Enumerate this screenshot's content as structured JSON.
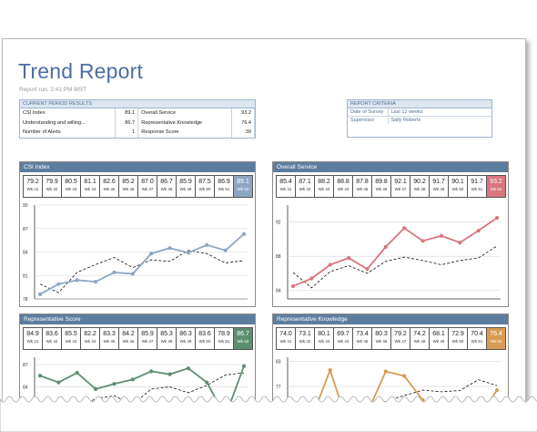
{
  "report": {
    "title": "Trend Report",
    "run": "Report run: 2:41 PM MST"
  },
  "results": {
    "header": "CURRENT PERIOD RESULTS",
    "rows": [
      [
        "CSI Index",
        "89.1",
        "Overall Service",
        "93.2"
      ],
      [
        "Understanding and willing...",
        "86.7",
        "Representative Knowledge",
        "76.4"
      ],
      [
        "Number of Alerts",
        "1",
        "Response Score",
        "39"
      ]
    ]
  },
  "criteria": {
    "header": "REPORT CRITERIA",
    "rows": [
      [
        "Date of Survey",
        "Last 12 weeks"
      ],
      [
        "Supervisor",
        "Sally Roberts"
      ]
    ]
  },
  "colors": {
    "header_blue": "#5d7d9e",
    "csi": "#8ea6c2",
    "overall": "#d9767f",
    "rep_score": "#5c8f70",
    "rep_knowledge": "#d99a52"
  },
  "panels": [
    {
      "title": "CSI Index",
      "color": "#8ea6c2",
      "weeks": [
        "Wk 41",
        "Wk 42",
        "Wk 43",
        "Wk 44",
        "Wk 45",
        "Wk 46",
        "Wk 47",
        "Wk 48",
        "Wk 49",
        "Wk 50",
        "Wk 51",
        "Wk 52"
      ],
      "values_text": [
        "79.2",
        "79.9",
        "80.5",
        "81.1",
        "82.6",
        "85.2",
        "87.0",
        "86.7",
        "85.9",
        "87.5",
        "86.9",
        "89.1"
      ],
      "yticks": [
        "90",
        "87",
        "84",
        "81",
        "78"
      ]
    },
    {
      "title": "Overall Service",
      "color": "#d9767f",
      "weeks": [
        "Wk 41",
        "Wk 42",
        "Wk 43",
        "Wk 44",
        "Wk 45",
        "Wk 46",
        "Wk 47",
        "Wk 48",
        "Wk 49",
        "Wk 50",
        "Wk 51",
        "Wk 52"
      ],
      "values_text": [
        "85.4",
        "87.1",
        "88.2",
        "88.8",
        "87.8",
        "89.8",
        "92.1",
        "90.2",
        "91.7",
        "90.1",
        "91.7",
        "93.2"
      ],
      "yticks": [
        "92",
        "88",
        "84"
      ]
    },
    {
      "title": "Representative Score",
      "color": "#5c8f70",
      "weeks": [
        "Wk 41",
        "Wk 42",
        "Wk 43",
        "Wk 44",
        "Wk 45",
        "Wk 46",
        "Wk 47",
        "Wk 48",
        "Wk 49",
        "Wk 50",
        "Wk 51",
        "Wk 52"
      ],
      "values_text": [
        "84.9",
        "83.6",
        "85.5",
        "82.2",
        "83.3",
        "84.2",
        "85.9",
        "85.3",
        "86.3",
        "83.6",
        "78.9",
        "86.7"
      ],
      "yticks": [
        "87",
        "84"
      ]
    },
    {
      "title": "Representative Knowledge",
      "color": "#d99a52",
      "weeks": [
        "Wk 41",
        "Wk 42",
        "Wk 43",
        "Wk 44",
        "Wk 45",
        "Wk 46",
        "Wk 47",
        "Wk 48",
        "Wk 49",
        "Wk 50",
        "Wk 51",
        "Wk 52"
      ],
      "values_text": [
        "74.0",
        "73.1",
        "80.1",
        "69.7",
        "73.4",
        "80.3",
        "79.2",
        "74.2",
        "68.1",
        "72.9",
        "70.4",
        "76.4"
      ],
      "yticks": [
        "83",
        "77"
      ]
    }
  ],
  "chart_data": [
    {
      "type": "line",
      "title": "CSI Index",
      "x": [
        "Wk 41",
        "Wk 42",
        "Wk 43",
        "Wk 44",
        "Wk 45",
        "Wk 46",
        "Wk 47",
        "Wk 48",
        "Wk 49",
        "Wk 50",
        "Wk 51",
        "Wk 52"
      ],
      "ylim": [
        78,
        90
      ],
      "series": [
        {
          "values": [
            78.6,
            79.9,
            80.4,
            80.2,
            81.4,
            81.2,
            83.8,
            84.5,
            83.9,
            84.9,
            84.2,
            86.3
          ]
        },
        {
          "values": [
            79.9,
            78.8,
            81.4,
            82.4,
            83.3,
            82.0,
            83.0,
            82.8,
            84.2,
            83.8,
            82.6,
            82.9
          ]
        }
      ]
    },
    {
      "type": "line",
      "title": "Overall Service",
      "x": [
        "Wk 41",
        "Wk 42",
        "Wk 43",
        "Wk 44",
        "Wk 45",
        "Wk 46",
        "Wk 47",
        "Wk 48",
        "Wk 49",
        "Wk 50",
        "Wk 51",
        "Wk 52"
      ],
      "ylim": [
        83,
        94
      ],
      "series": [
        {
          "values": [
            84.5,
            85.4,
            87.0,
            87.8,
            86.5,
            89.1,
            91.3,
            89.8,
            90.4,
            89.6,
            91.0,
            92.5
          ]
        },
        {
          "values": [
            86.1,
            84.3,
            86.2,
            86.9,
            86.0,
            87.4,
            87.9,
            87.5,
            87.0,
            87.5,
            87.8,
            89.2
          ]
        }
      ]
    },
    {
      "type": "line",
      "title": "Representative Score",
      "x": [
        "Wk 41",
        "Wk 42",
        "Wk 43",
        "Wk 44",
        "Wk 45",
        "Wk 46",
        "Wk 47",
        "Wk 48",
        "Wk 49",
        "Wk 50",
        "Wk 51",
        "Wk 52"
      ],
      "ylim": [
        79,
        88
      ],
      "series": [
        {
          "values": [
            85.5,
            84.6,
            85.9,
            83.7,
            84.4,
            85.0,
            86.1,
            85.7,
            86.5,
            84.6,
            80.0,
            86.8
          ]
        },
        {
          "values": [
            80.6,
            80.3,
            81.1,
            82.4,
            82.8,
            81.6,
            83.7,
            84.0,
            83.2,
            84.2,
            85.6,
            85.9
          ]
        }
      ]
    },
    {
      "type": "line",
      "title": "Representative Knowledge",
      "x": [
        "Wk 41",
        "Wk 42",
        "Wk 43",
        "Wk 44",
        "Wk 45",
        "Wk 46",
        "Wk 47",
        "Wk 48",
        "Wk 49",
        "Wk 50",
        "Wk 51",
        "Wk 52"
      ],
      "ylim": [
        68,
        84
      ],
      "series": [
        {
          "values": [
            70.5,
            69.4,
            80.9,
            67.3,
            70.6,
            80.6,
            79.5,
            73.7,
            67.9,
            72.2,
            69.3,
            76.1
          ]
        },
        {
          "values": [
            71.5,
            72.0,
            71.0,
            71.8,
            72.6,
            73.4,
            74.8,
            76.1,
            75.7,
            76.0,
            78.6,
            77.2
          ]
        }
      ]
    }
  ]
}
